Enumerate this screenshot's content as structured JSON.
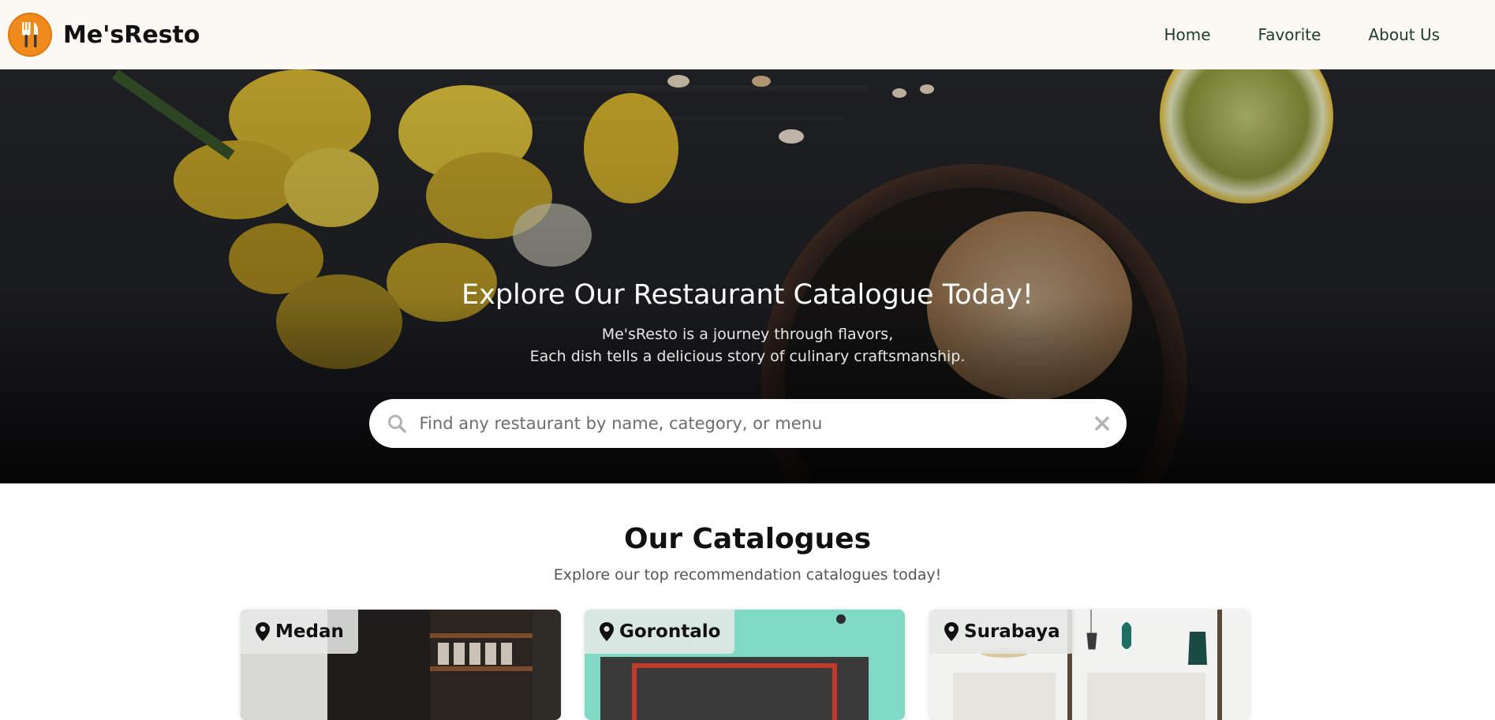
{
  "header": {
    "brand_name": "Me'sResto",
    "logo_icon": "fork-knife-icon",
    "nav": [
      "Home",
      "Favorite",
      "About Us"
    ]
  },
  "hero": {
    "title": "Explore Our Restaurant Catalogue Today!",
    "subtitle_line1": "Me'sResto is a journey through flavors,",
    "subtitle_line2": "Each dish tells a delicious story of culinary craftsmanship.",
    "search": {
      "placeholder": "Find any restaurant by name, category, or menu",
      "value": "",
      "icon": "search-icon",
      "clear_icon": "close-icon"
    }
  },
  "catalogue": {
    "title": "Our Catalogues",
    "subtitle": "Explore our top recommendation catalogues today!",
    "cards": [
      {
        "city": "Medan",
        "icon": "map-pin-icon"
      },
      {
        "city": "Gorontalo",
        "icon": "map-pin-icon"
      },
      {
        "city": "Surabaya",
        "icon": "map-pin-icon"
      }
    ]
  },
  "colors": {
    "header_bg": "#fcf8f3",
    "nav_text": "#1f3b2c",
    "logo_orange": "#f08a1c",
    "hero_dark": "#1c1c1e"
  }
}
